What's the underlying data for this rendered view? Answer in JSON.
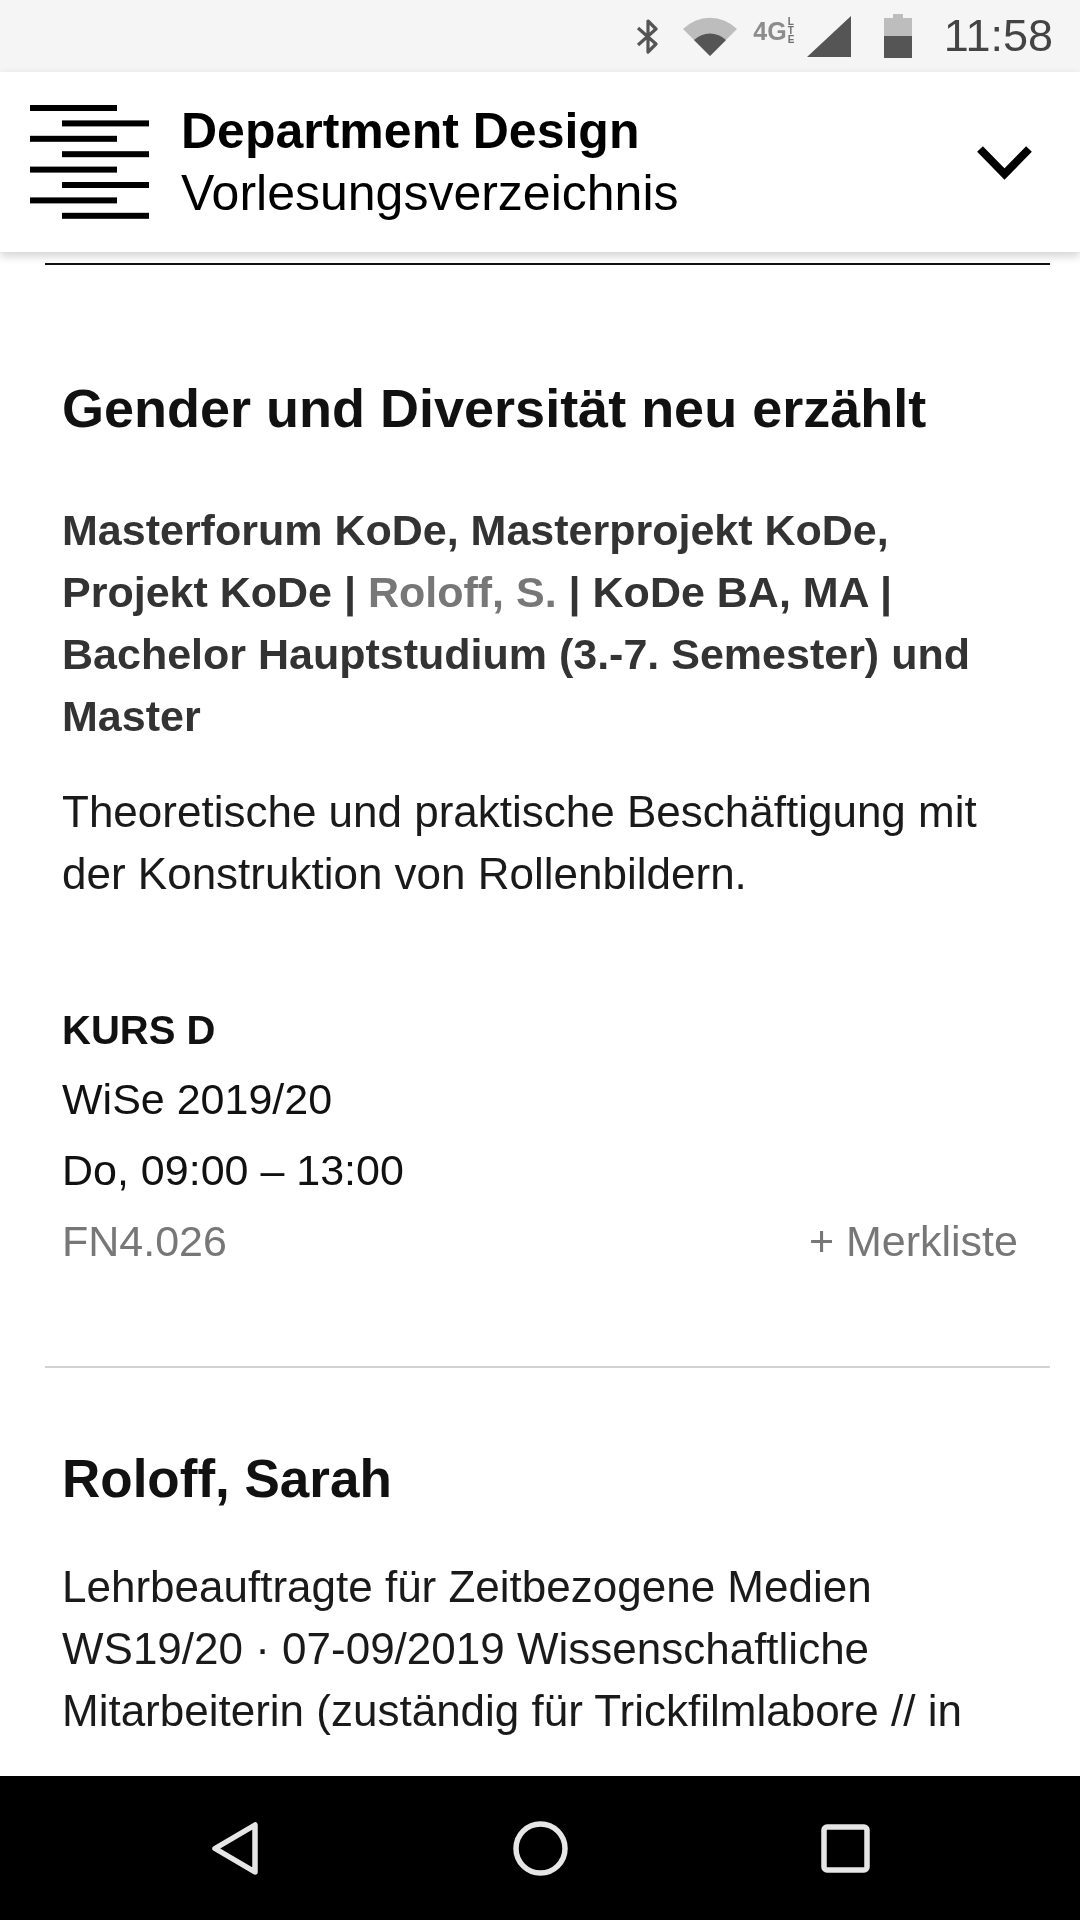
{
  "status_bar": {
    "network": "4G",
    "network_sub": "LTE",
    "time": "11:58"
  },
  "header": {
    "title": "Department Design",
    "subtitle": "Vorlesungsverzeichnis"
  },
  "course": {
    "title": "Gender und Diversität neu erzählt",
    "meta": [
      {
        "kind": "text",
        "text": "Masterforum KoDe, Masterprojekt KoDe, Projekt KoDe | "
      },
      {
        "kind": "link",
        "text": "Roloff, S."
      },
      {
        "kind": "text",
        "text": " | KoDe BA, MA | Bachelor Hauptstudium (3.-7. Semester) und Master"
      }
    ],
    "description": "Theoretische und praktische Beschäftigung mit der Konstruktion von Rollenbildern.",
    "section": {
      "label": "KURS D",
      "semester": "WiSe 2019/20",
      "schedule": "Do, 09:00 – 13:00",
      "room": "FN4.026",
      "bookmark": "+ Merkliste"
    }
  },
  "person": {
    "name": "Roloff, Sarah",
    "bio": "Lehrbeauftragte für Zeitbezogene Medien WS19/20 · 07-09/2019 Wissenschaftliche Mitarbeiterin (zuständig für Trickfilmlabore // in"
  }
}
